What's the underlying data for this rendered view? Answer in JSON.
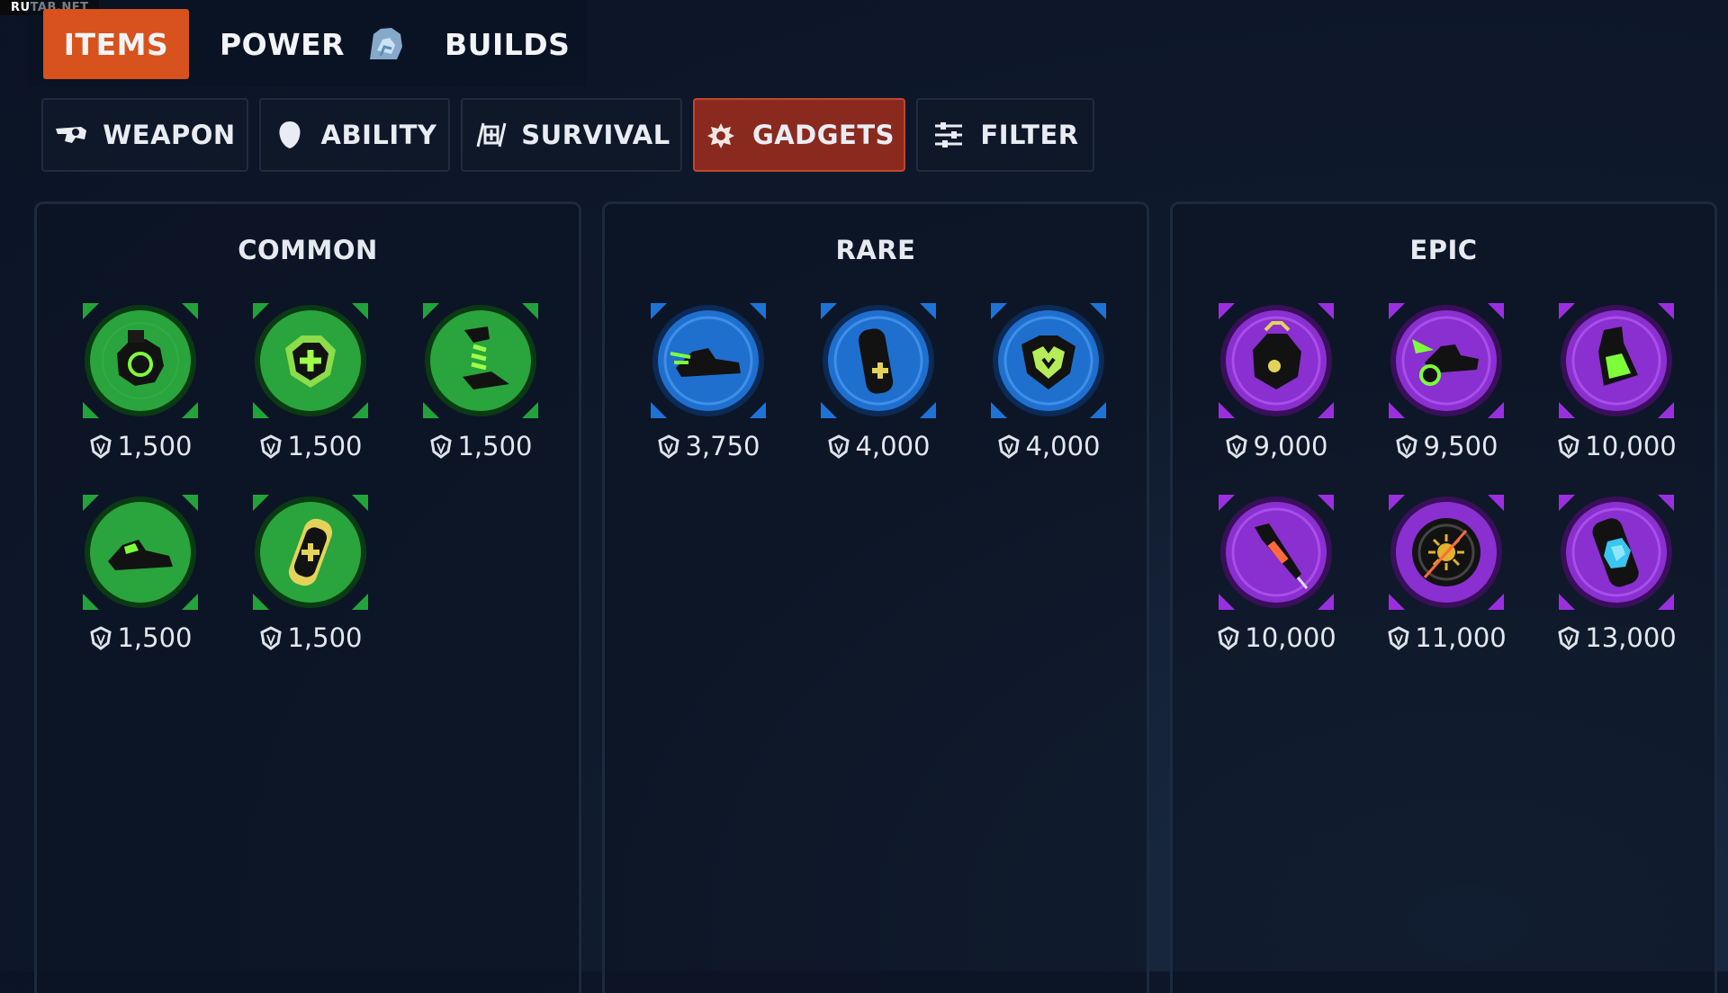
{
  "watermark": "RUTAB.NET",
  "top_tabs": [
    {
      "label": "ITEMS",
      "active": true
    },
    {
      "label": "POWER",
      "active": false
    },
    {
      "label": "BUILDS",
      "active": false
    }
  ],
  "sub_tabs": [
    {
      "label": "WEAPON",
      "icon": "weapon-icon",
      "active": false
    },
    {
      "label": "ABILITY",
      "icon": "ability-icon",
      "active": false
    },
    {
      "label": "SURVIVAL",
      "icon": "survival-icon",
      "active": false
    },
    {
      "label": "GADGETS",
      "icon": "gadgets-icon",
      "active": true
    },
    {
      "label": "FILTER",
      "icon": "filter-sliders-icon",
      "active": false
    }
  ],
  "colors": {
    "items_tab": "#d7521c",
    "gadgets_tab": "#8a2a1f",
    "common": "#22a33a",
    "rare": "#1e73d6",
    "epic": "#9b2fe0"
  },
  "tiers": [
    {
      "title": "COMMON",
      "items": [
        {
          "price": "1,500",
          "icon": "bomb-gadget-icon"
        },
        {
          "price": "1,500",
          "icon": "shield-plus-gadget-icon"
        },
        {
          "price": "1,500",
          "icon": "spring-boot-gadget-icon"
        },
        {
          "price": "1,500",
          "icon": "sneaker-gadget-icon"
        },
        {
          "price": "1,500",
          "icon": "health-canister-gadget-icon"
        }
      ]
    },
    {
      "title": "RARE",
      "items": [
        {
          "price": "3,750",
          "icon": "speed-sneaker-gadget-icon"
        },
        {
          "price": "4,000",
          "icon": "canister-plus-gadget-icon"
        },
        {
          "price": "4,000",
          "icon": "shield-heart-gadget-icon"
        }
      ]
    },
    {
      "title": "EPIC",
      "items": [
        {
          "price": "9,000",
          "icon": "bomb-bag-gadget-icon"
        },
        {
          "price": "9,500",
          "icon": "winged-sneaker-gadget-icon"
        },
        {
          "price": "10,000",
          "icon": "flask-gadget-icon"
        },
        {
          "price": "10,000",
          "icon": "syringe-gadget-icon"
        },
        {
          "price": "11,000",
          "icon": "sun-disc-gadget-icon"
        },
        {
          "price": "13,000",
          "icon": "crystal-canister-gadget-icon"
        }
      ]
    }
  ]
}
